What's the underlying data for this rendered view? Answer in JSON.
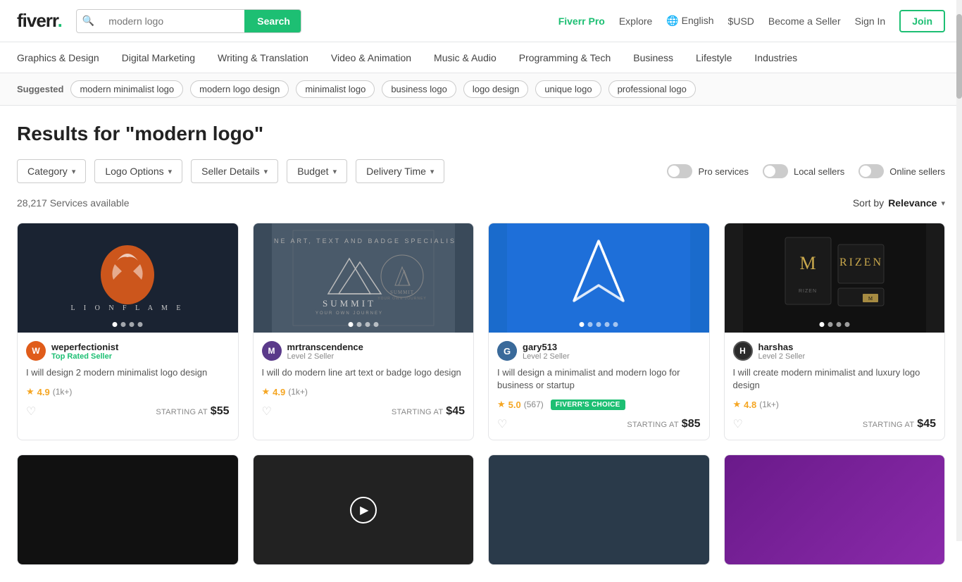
{
  "header": {
    "logo_text": "fiverr",
    "logo_dot": ".",
    "search_placeholder": "modern logo",
    "search_btn_label": "Search",
    "nav_pro": "Fiverr Pro",
    "nav_explore": "Explore",
    "nav_language": "English",
    "nav_currency": "$USD",
    "nav_become_seller": "Become a Seller",
    "nav_sign_in": "Sign In",
    "nav_join": "Join"
  },
  "nav": {
    "items": [
      "Graphics & Design",
      "Digital Marketing",
      "Writing & Translation",
      "Video & Animation",
      "Music & Audio",
      "Programming & Tech",
      "Business",
      "Lifestyle",
      "Industries"
    ]
  },
  "suggested": {
    "label": "Suggested",
    "tags": [
      "modern minimalist logo",
      "modern logo design",
      "minimalist logo",
      "business logo",
      "logo design",
      "unique logo",
      "professional logo"
    ]
  },
  "results": {
    "title": "Results for \"modern logo\"",
    "count": "28,217 Services available",
    "sort_label": "Sort by",
    "sort_value": "Relevance"
  },
  "filters": {
    "category": "Category",
    "logo_options": "Logo Options",
    "seller_details": "Seller Details",
    "budget": "Budget",
    "delivery_time": "Delivery Time",
    "pro_services": "Pro services",
    "local_sellers": "Local sellers",
    "online_sellers": "Online sellers"
  },
  "cards": [
    {
      "seller_name": "weperfectionist",
      "seller_level": "Top Rated Seller",
      "seller_level_type": "top",
      "avatar_color": "#e05c1a",
      "avatar_initials": "W",
      "title": "I will design 2 modern minimalist logo design",
      "rating": "4.9",
      "rating_count": "(1k+)",
      "fiverrs_choice": false,
      "starting_label": "STARTING AT",
      "price": "$55",
      "img_type": "dark-navy",
      "dots": 4,
      "active_dot": 0
    },
    {
      "seller_name": "mrtranscendence",
      "seller_level": "Level 2 Seller",
      "seller_level_type": "level",
      "avatar_color": "#5a3a8a",
      "avatar_initials": "M",
      "title": "I will do modern line art text or badge logo design",
      "rating": "4.9",
      "rating_count": "(1k+)",
      "fiverrs_choice": false,
      "starting_label": "STARTING AT",
      "price": "$45",
      "img_type": "mountain",
      "dots": 4,
      "active_dot": 0
    },
    {
      "seller_name": "gary513",
      "seller_level": "Level 2 Seller",
      "seller_level_type": "level",
      "avatar_color": "#3a6a9a",
      "avatar_initials": "G",
      "title": "I will design a minimalist and modern logo for business or startup",
      "rating": "5.0",
      "rating_count": "(567)",
      "fiverrs_choice": true,
      "starting_label": "STARTING AT",
      "price": "$85",
      "img_type": "blue",
      "dots": 5,
      "active_dot": 0
    },
    {
      "seller_name": "harshas",
      "seller_level": "Level 2 Seller",
      "seller_level_type": "level",
      "avatar_color": "#2a2a2a",
      "avatar_initials": "H",
      "title": "I will create modern minimalist and luxury logo design",
      "rating": "4.8",
      "rating_count": "(1k+)",
      "fiverrs_choice": false,
      "starting_label": "STARTING AT",
      "price": "$45",
      "img_type": "dark-gold",
      "dots": 4,
      "active_dot": 0
    }
  ],
  "second_row_cards": [
    {
      "img_type": "black"
    },
    {
      "img_type": "video"
    },
    {
      "img_type": "crystal"
    },
    {
      "img_type": "purple"
    }
  ]
}
